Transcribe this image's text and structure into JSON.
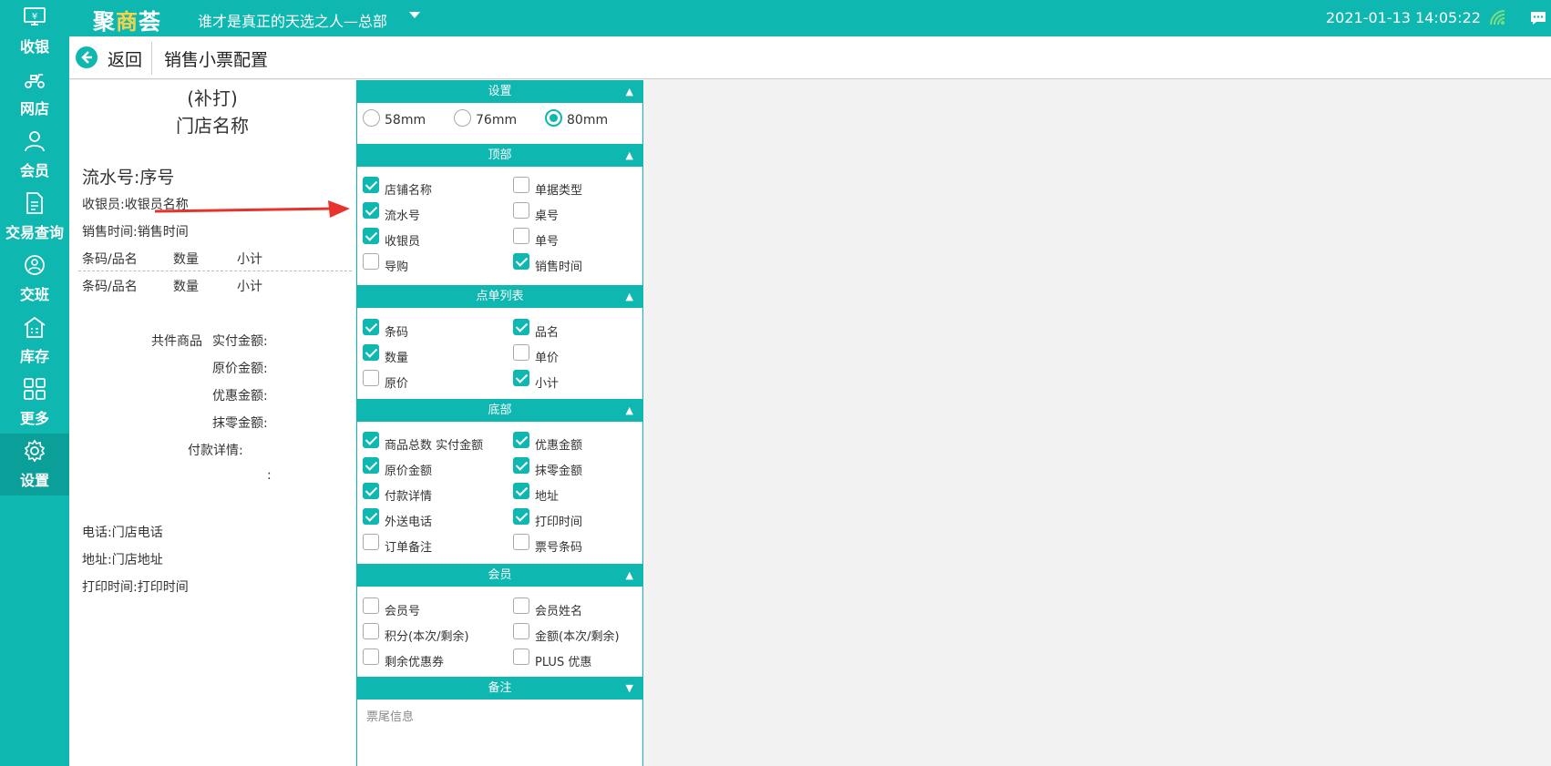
{
  "app": {
    "logo_pre": "聚",
    "logo_accent": "商",
    "logo_post": "荟",
    "store_name": "谁才是真正的天选之人—总部",
    "datetime": "2021-01-13 14:05:22"
  },
  "nav": [
    {
      "label": "收银",
      "icon": "cash-register-icon"
    },
    {
      "label": "网店",
      "icon": "delivery-scooter-icon"
    },
    {
      "label": "会员",
      "icon": "user-icon"
    },
    {
      "label": "交易查询",
      "icon": "document-icon"
    },
    {
      "label": "交班",
      "icon": "shift-handover-icon"
    },
    {
      "label": "库存",
      "icon": "warehouse-icon"
    },
    {
      "label": "更多",
      "icon": "grid-icon"
    },
    {
      "label": "设置",
      "icon": "gear-icon"
    }
  ],
  "header": {
    "back_label": "返回",
    "title": "销售小票配置"
  },
  "preview": {
    "reprint": "(补打)",
    "store_name": "门店名称",
    "serial": "流水号:序号",
    "cashier": "收银员:收银员名称",
    "sale_time": "销售时间:销售时间",
    "col1": "条码/品名",
    "col2": "数量",
    "col3": "小计",
    "total_items": "共件商品",
    "paid": "实付金额:",
    "original": "原价金额:",
    "discount": "优惠金额:",
    "rounding": "抹零金额:",
    "payment_detail": "付款详情:",
    "colon": ":",
    "phone": "电话:门店电话",
    "address": "地址:门店地址",
    "print_time": "打印时间:打印时间"
  },
  "settings": {
    "sections": {
      "setting": "设置",
      "top": "顶部",
      "order_list": "点单列表",
      "bottom": "底部",
      "member": "会员",
      "remark": "备注"
    },
    "paper_sizes": [
      {
        "label": "58mm",
        "selected": false
      },
      {
        "label": "76mm",
        "selected": false
      },
      {
        "label": "80mm",
        "selected": true
      }
    ],
    "top_items": [
      {
        "label": "店铺名称",
        "checked": true
      },
      {
        "label": "单据类型",
        "checked": false
      },
      {
        "label": "流水号",
        "checked": true
      },
      {
        "label": "桌号",
        "checked": false
      },
      {
        "label": "收银员",
        "checked": true
      },
      {
        "label": "单号",
        "checked": false
      },
      {
        "label": "导购",
        "checked": false
      },
      {
        "label": "销售时间",
        "checked": true
      }
    ],
    "list_items": [
      {
        "label": "条码",
        "checked": true
      },
      {
        "label": "品名",
        "checked": true
      },
      {
        "label": "数量",
        "checked": true
      },
      {
        "label": "单价",
        "checked": false
      },
      {
        "label": "原价",
        "checked": false
      },
      {
        "label": "小计",
        "checked": true
      }
    ],
    "bottom_items": [
      {
        "label": "商品总数 实付金额",
        "checked": true
      },
      {
        "label": "优惠金额",
        "checked": true
      },
      {
        "label": "原价金额",
        "checked": true
      },
      {
        "label": "抹零金额",
        "checked": true
      },
      {
        "label": "付款详情",
        "checked": true
      },
      {
        "label": "地址",
        "checked": true
      },
      {
        "label": "外送电话",
        "checked": true
      },
      {
        "label": "打印时间",
        "checked": true
      },
      {
        "label": "订单备注",
        "checked": false
      },
      {
        "label": "票号条码",
        "checked": false
      }
    ],
    "member_items": [
      {
        "label": "会员号",
        "checked": false
      },
      {
        "label": "会员姓名",
        "checked": false
      },
      {
        "label": "积分(本次/剩余)",
        "checked": false
      },
      {
        "label": "金额(本次/剩余)",
        "checked": false
      },
      {
        "label": "剩余优惠券",
        "checked": false
      },
      {
        "label": "PLUS 优惠",
        "checked": false
      }
    ],
    "remark_placeholder": "票尾信息"
  },
  "colors": {
    "accent": "#0fb7b1",
    "arrow": "#e8322c"
  }
}
